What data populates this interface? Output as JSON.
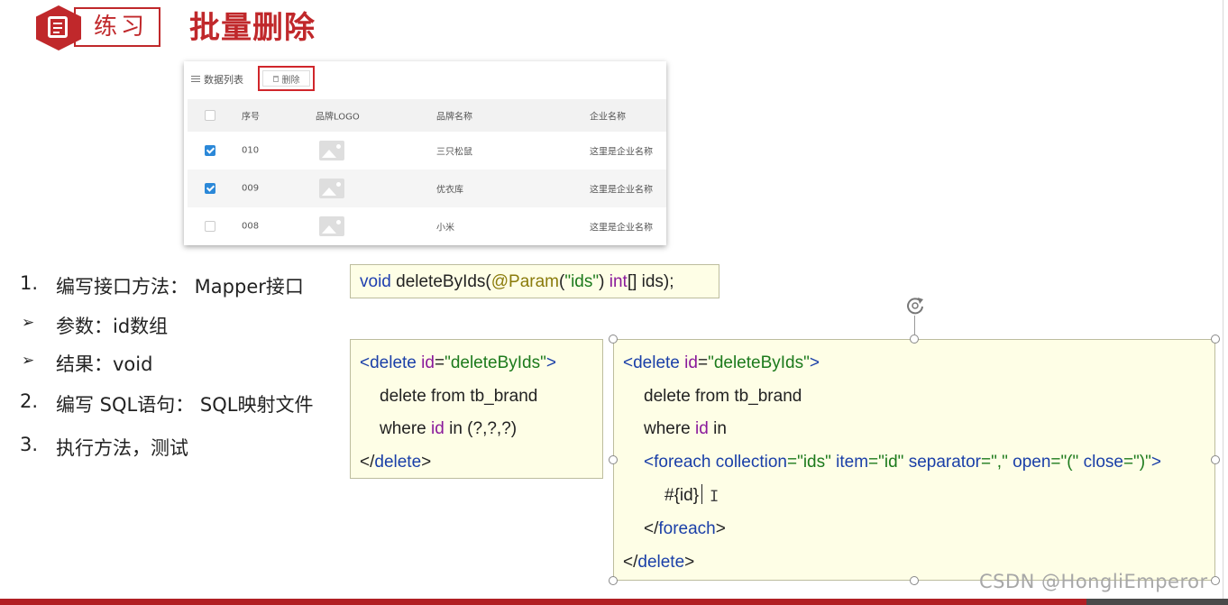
{
  "header": {
    "badge_label": "练习",
    "title": "批量删除"
  },
  "table": {
    "list_label": "数据列表",
    "delete_button": "删除",
    "columns": [
      "序号",
      "品牌LOGO",
      "品牌名称",
      "企业名称"
    ],
    "rows": [
      {
        "checked": true,
        "id": "010",
        "brand": "三只松鼠",
        "company": "这里是企业名称"
      },
      {
        "checked": true,
        "id": "009",
        "brand": "优衣库",
        "company": "这里是企业名称"
      },
      {
        "checked": false,
        "id": "008",
        "brand": "小米",
        "company": "这里是企业名称"
      }
    ]
  },
  "steps": {
    "s1_num": "1.",
    "s1_text": "编写接口方法：  Mapper接口",
    "b1_text": "参数：id数组",
    "b2_text": "结果：void",
    "s2_num": "2.",
    "s2_text": "编写 SQL语句：  SQL映射文件",
    "s3_num": "3.",
    "s3_text": "执行方法，测试",
    "bullet_glyph": "➢"
  },
  "code": {
    "method": {
      "void": "void",
      "name": " deleteByIds(",
      "annotation": "@Param",
      "paren_open": "(",
      "arg": "\"ids\"",
      "paren_close": ") ",
      "int": "int",
      "rest": "[] ids);"
    },
    "sql_simple": {
      "l1_open": "<",
      "l1_tag": "delete",
      "l1_attr": " id",
      "l1_eq": "=",
      "l1_val": "\"deleteByIds\"",
      "l1_close": ">",
      "l2": "delete from tb_brand",
      "l3_a": "where ",
      "l3_id": "id",
      "l3_b": " in (?,?,?)",
      "l4_open": "</",
      "l4_tag": "delete",
      "l4_close": ">"
    },
    "sql_foreach": {
      "l1_open": "<",
      "l1_tag": "delete",
      "l1_attr": " id",
      "l1_eq": "=",
      "l1_val": "\"deleteByIds\"",
      "l1_close": ">",
      "l2": "delete from tb_brand",
      "l3_a": "where ",
      "l3_id": "id",
      "l3_b": " in",
      "l4_open": "<",
      "l4_tag": "foreach",
      "l4_a1": " collection",
      "l4_v1": "=\"ids\"",
      "l4_a2": " item",
      "l4_v2": "=\"id\"",
      "l4_a3": " separator",
      "l4_v3": "=\",\"",
      "l4_a4": " open",
      "l4_v4": "=\"(\"",
      "l4_a5": " close",
      "l4_v5": "=\")\"",
      "l4_close": ">",
      "l5": "#{id}",
      "l6_open": "</",
      "l6_tag": "foreach",
      "l6_close": ">",
      "l7_open": "</",
      "l7_tag": "delete",
      "l7_close": ">"
    }
  },
  "watermark": "CSDN @HongliEmperor",
  "colors": {
    "brand_red": "#c0282b",
    "keyword_blue": "#1a3fa8",
    "keyword_purple": "#8a1a9b",
    "string_green": "#1c7a1c",
    "annotation_olive": "#8a7b0b",
    "code_bg": "#fefee6"
  }
}
